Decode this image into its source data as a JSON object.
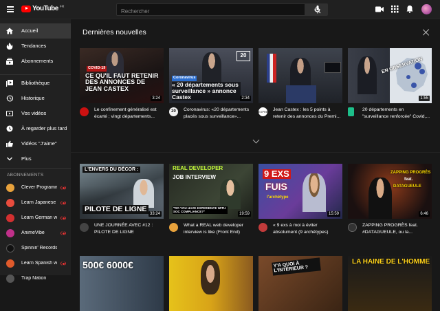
{
  "header": {
    "logo_text": "YouTube",
    "logo_country": "FR",
    "search_placeholder": "Rechercher"
  },
  "sidebar": {
    "items": [
      {
        "label": "Accueil",
        "icon": "home-icon",
        "active": true
      },
      {
        "label": "Tendances",
        "icon": "flame-icon"
      },
      {
        "label": "Abonnements",
        "icon": "subscriptions-icon"
      },
      {
        "label": "Bibliothèque",
        "icon": "library-icon"
      },
      {
        "label": "Historique",
        "icon": "history-icon"
      },
      {
        "label": "Vos vidéos",
        "icon": "your-videos-icon"
      },
      {
        "label": "À regarder plus tard",
        "icon": "watch-later-icon"
      },
      {
        "label": "Vidéos \"J'aime\"",
        "icon": "thumb-up-icon"
      },
      {
        "label": "Plus",
        "icon": "chevron-down-icon"
      }
    ],
    "subscriptions_heading": "ABONNEMENTS",
    "subscriptions": [
      {
        "label": "Clever Programmer",
        "color": "#e8a23c",
        "live": true
      },
      {
        "label": "Learn Japanese wi...",
        "color": "#e84c3d",
        "live": true
      },
      {
        "label": "Learn German with...",
        "color": "#d33030",
        "live": true
      },
      {
        "label": "AnimeVibe",
        "color": "#c0308a",
        "live": true
      },
      {
        "label": "Spinnin' Records",
        "color": "#222222",
        "live": false
      },
      {
        "label": "Learn Spanish with...",
        "color": "#e05a2b",
        "live": true
      },
      {
        "label": "Trap Nation",
        "color": "#555555",
        "live": false
      }
    ]
  },
  "main": {
    "section_title": "Dernières nouvelles",
    "news": [
      {
        "title": "Le confinement généralisé est écarté ; vingt départements...",
        "duration": "3:24",
        "caption_tag": "COVID-19",
        "caption": "CE QU'IL FAUT RETENIR DES ANNONCES DE JEAN CASTEX",
        "channel_color": "#cc1111"
      },
      {
        "title": "Coronavirus: «20 départements placés sous surveillance»...",
        "duration": "2:34",
        "caption_tag": "Coronavirus",
        "caption": "« 20 départements sous surveillance » annonce Castex",
        "channel_color": "#f2f2f2"
      },
      {
        "title": "Jean Castex : les 5 points à retenir des annonces du Premi...",
        "duration": "",
        "caption_tag": "",
        "caption": "",
        "channel_color": "#ffffff"
      },
      {
        "title": "20 départements en \"surveillance renforcée\" Covid,...",
        "duration": "1:55",
        "caption_tag": "EN OBSERVATION",
        "caption": "",
        "channel_color": "#1dbf8a"
      }
    ],
    "videos": [
      {
        "title": "UNE JOURNÉE AVEC #12 : PILOTE DE LIGNE",
        "duration": "33:24",
        "caption_top": "L'ENVERS DU DÉCOR :",
        "caption_bottom": "PILOTE DE LIGNE",
        "channel_color": "#444444"
      },
      {
        "title": "What a REAL web developer interview is like (Front End)",
        "duration": "19:59",
        "caption_top": "REAL DEVELOPER",
        "caption_mid": "JOB INTERVIEW",
        "caption_bottom": "\"DO YOU HAVE EXPERIENCE WITH SOC COMPLIANCE?\"",
        "channel_color": "#e8a23c"
      },
      {
        "title": "« 9 exs à moi à éviter absolument (9 archétypes)",
        "duration": "15:59",
        "caption_top": "9 EXS",
        "caption_mid": "FUIS",
        "caption_bottom": "l'archétype",
        "channel_color": "#c23b3b"
      },
      {
        "title": "ZAPPING PROGRÈS feat. #DATAGUEULE, ou la...",
        "duration": "6:46",
        "caption_top": "ZAPPING PROGRÈS",
        "caption_mid": "feat.",
        "caption_bottom": "DATAGUEULE",
        "channel_color": "#333333"
      }
    ],
    "third_row": [
      {
        "caption": "500€ 6000€"
      },
      {
        "caption": ""
      },
      {
        "caption": "Y'A QUOI À L'INTÉRIEUR ?"
      },
      {
        "caption": "LA HAINE DE L'HOMME"
      }
    ]
  }
}
